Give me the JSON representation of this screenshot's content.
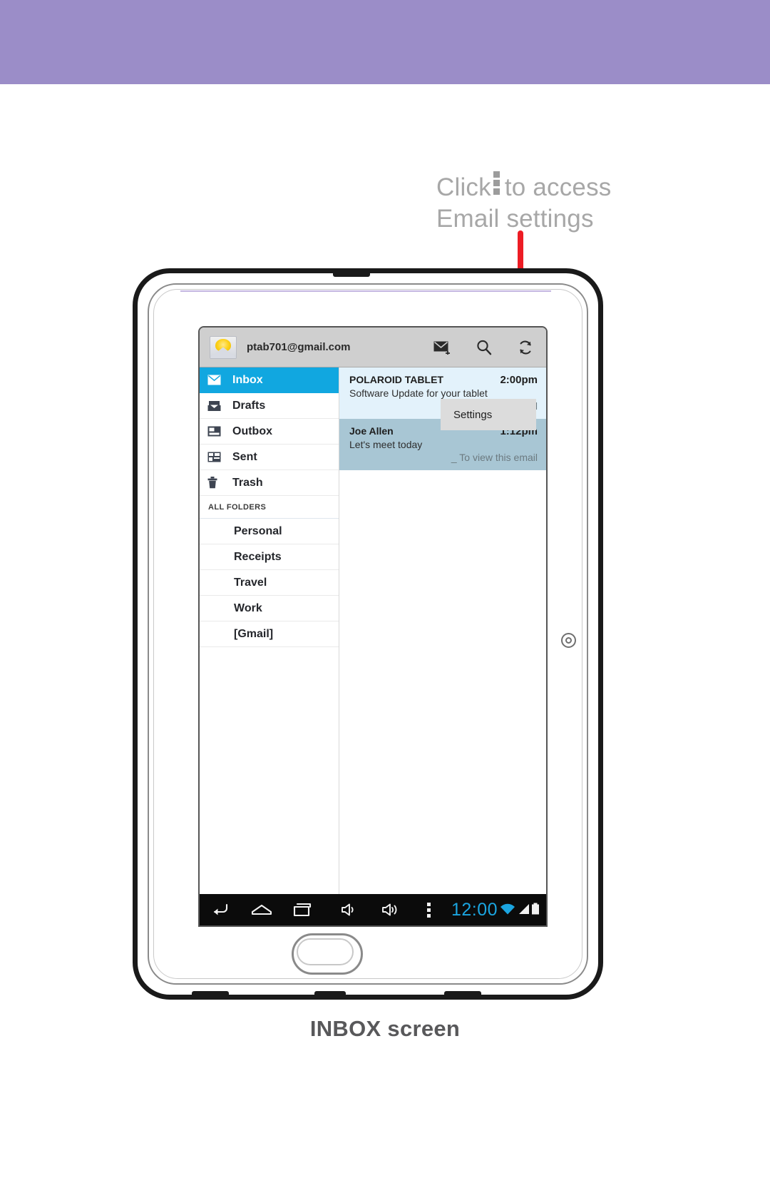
{
  "callout": {
    "line1_before": "Click",
    "icon": "kebab-menu-icon",
    "line1_after": "to access",
    "line2": "Email settings"
  },
  "caption": "INBOX screen",
  "colors": {
    "band": "#9b8dc8",
    "pointer": "#ed1c24",
    "accent_selected": "#11a7e0",
    "unread_row": "#e3f2fb",
    "selected_row": "#a8c6d4",
    "clock": "#1ba5e0",
    "caption_text": "#58585a",
    "callout_text": "#a7a7a7"
  },
  "app_bar": {
    "account_email": "ptab701@gmail.com",
    "account_icon": "mail-sun-avatar-icon",
    "actions": [
      {
        "name": "compose-icon",
        "label": "Compose"
      },
      {
        "name": "search-icon",
        "label": "Search"
      },
      {
        "name": "refresh-icon",
        "label": "Refresh"
      }
    ]
  },
  "folders": {
    "system": [
      {
        "label": "Inbox",
        "icon": "inbox-envelope-icon",
        "selected": true
      },
      {
        "label": "Drafts",
        "icon": "drafts-icon",
        "selected": false
      },
      {
        "label": "Outbox",
        "icon": "outbox-icon",
        "selected": false
      },
      {
        "label": "Sent",
        "icon": "sent-icon",
        "selected": false
      },
      {
        "label": "Trash",
        "icon": "trash-can-icon",
        "selected": false
      }
    ],
    "section_header": "ALL FOLDERS",
    "all": [
      {
        "label": "Personal"
      },
      {
        "label": "Receipts"
      },
      {
        "label": "Travel"
      },
      {
        "label": "Work"
      },
      {
        "label": "[Gmail]"
      }
    ]
  },
  "messages": [
    {
      "sender": "POLAROID TABLET",
      "time": "2:00pm",
      "subject": "Software Update for your tablet",
      "preview": "_ To view this email",
      "state": "unread"
    },
    {
      "sender": "Joe Allen",
      "time": "1:12pm",
      "subject": "Let's meet today",
      "preview": "_ To view this email",
      "state": "selected"
    }
  ],
  "settings_popup": {
    "label": "Settings"
  },
  "nav_bar": {
    "buttons": [
      {
        "name": "back-icon",
        "label": "Back"
      },
      {
        "name": "home-icon",
        "label": "Home"
      },
      {
        "name": "recent-apps-icon",
        "label": "Recent apps"
      },
      {
        "name": "volume-down-icon",
        "label": "Volume down"
      },
      {
        "name": "volume-up-icon",
        "label": "Volume up"
      },
      {
        "name": "kebab-menu-icon",
        "label": "Menu"
      }
    ],
    "clock": "12:00",
    "status_icons": [
      {
        "name": "wifi-icon",
        "label": "Wi-Fi"
      },
      {
        "name": "signal-icon",
        "label": "Signal"
      },
      {
        "name": "battery-icon",
        "label": "Battery"
      }
    ]
  },
  "device": {
    "camera_icon": "front-camera-icon",
    "home_button_label": "Home button"
  }
}
